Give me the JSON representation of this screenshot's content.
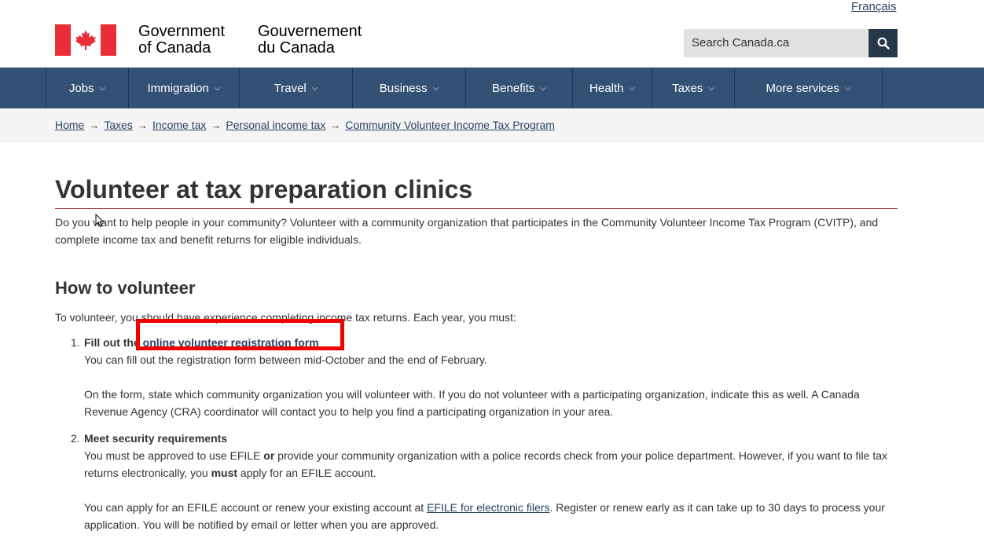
{
  "header": {
    "lang_link": "Français",
    "wordmark_en_line1": "Government",
    "wordmark_en_line2": "of Canada",
    "wordmark_fr_line1": "Gouvernement",
    "wordmark_fr_line2": "du Canada",
    "search_placeholder": "Search Canada.ca",
    "search_icon": "search-icon",
    "flag_icon": "maple-leaf-flag"
  },
  "nav": {
    "items": [
      {
        "label": "Jobs"
      },
      {
        "label": "Immigration"
      },
      {
        "label": "Travel"
      },
      {
        "label": "Business"
      },
      {
        "label": "Benefits"
      },
      {
        "label": "Health"
      },
      {
        "label": "Taxes"
      },
      {
        "label": "More services"
      }
    ]
  },
  "breadcrumb": {
    "items": [
      "Home",
      "Taxes",
      "Income tax",
      "Personal income tax",
      "Community Volunteer Income Tax Program"
    ]
  },
  "main": {
    "title": "Volunteer at tax preparation clinics",
    "intro": "Do you want to help people in your community? Volunteer with a community organization that participates in the Community Volunteer Income Tax Program (CVITP), and complete income tax and benefit returns for eligible individuals.",
    "section_title": "How to volunteer",
    "section_lead": "To volunteer, you should have experience completing income tax returns. Each year, you must:",
    "steps": [
      {
        "number": "1.",
        "title_prefix": "Fill out the ",
        "title_link": "online volunteer registration form",
        "p1": "You can fill out the registration form between mid-October and the end of February.",
        "p2": "On the form, state which community organization you will volunteer with. If you do not volunteer with a participating organization, indicate this as well. A Canada Revenue Agency (CRA) coordinator will contact you to help you find a participating organization in your area."
      },
      {
        "number": "2.",
        "title": "Meet security requirements",
        "p1_a": "You must be approved to use EFILE ",
        "p1_b": "or",
        "p1_c": " provide your community organization with a police records check from your police department. However, if you want to file tax returns electronically, you ",
        "p1_d": "must",
        "p1_e": " apply for an EFILE account.",
        "p2_a": "You can apply for an EFILE account or renew your existing account at ",
        "p2_link": "EFILE for electronic filers",
        "p2_b": ". Register or renew early as it can take up to 30 days to process your application. You will be notified by email or letter when you are approved."
      }
    ]
  },
  "colors": {
    "nav_bg": "#335075",
    "search_btn": "#26374a",
    "flag_red": "#eb2d37",
    "rule": "#af3c43",
    "highlight": "#ee0000"
  }
}
